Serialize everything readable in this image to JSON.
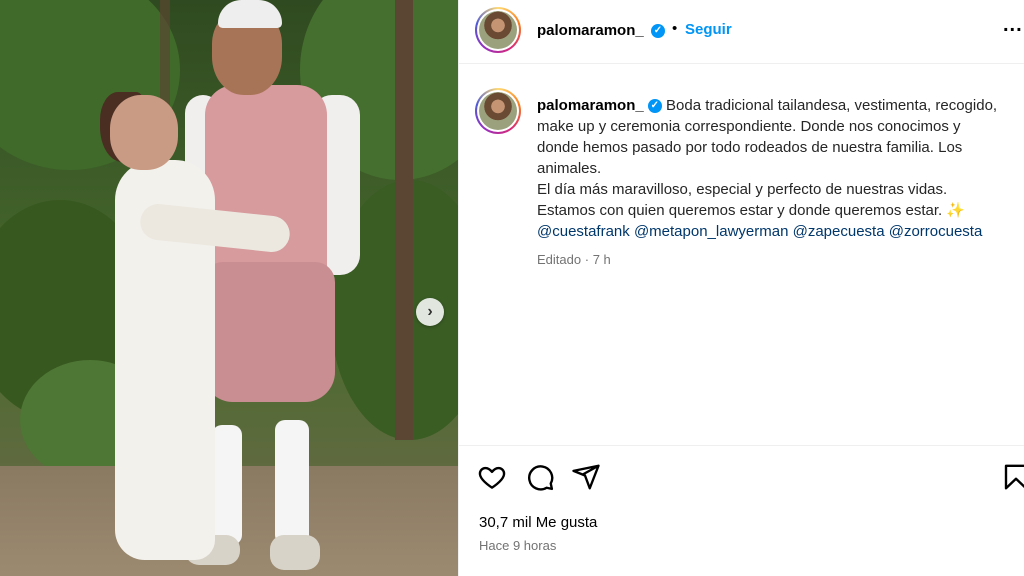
{
  "post": {
    "username": "palomaramon_",
    "follow_label": "Seguir",
    "separator": "•",
    "more_label": "...",
    "verified_symbol": "✓"
  },
  "caption": {
    "username": "palomaramon_",
    "lines": [
      "Boda tradicional tailandesa, vestimenta, recogido,",
      "make up y ceremonia correspondiente. Donde nos conocimos y",
      "donde hemos pasado por todo rodeados de nuestra familia. Los",
      "animales.",
      "El día más maravilloso, especial y perfecto de nuestras vidas.",
      "Estamos con quien queremos estar y donde queremos estar."
    ],
    "sparkle": "✨",
    "mentions": [
      "@cuestafrank",
      "@metapon_lawyerman",
      "@zapecuesta",
      "@zorrocuesta"
    ],
    "edited": "Editado",
    "edited_time": "7 h",
    "edited_sep": "·"
  },
  "footer": {
    "likes": "30,7 mil Me gusta",
    "time": "Hace 9 horas"
  },
  "photo": {
    "next_symbol": "›"
  },
  "icons": [
    "heart-icon",
    "comment-icon",
    "share-icon",
    "bookmark-icon",
    "verified-icon",
    "more-icon",
    "chevron-right-icon"
  ],
  "colors": {
    "accent": "#0095f6",
    "mention": "#00376b",
    "muted": "#737373"
  }
}
